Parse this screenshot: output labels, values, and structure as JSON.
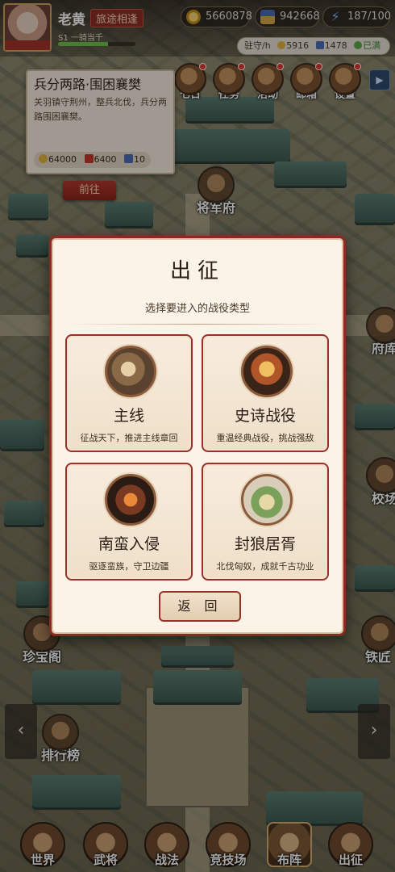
{
  "player": {
    "name": "老黄",
    "title_tag": "旅途相逢",
    "rank": "S1 一骑当千",
    "avatar_caption": "",
    "xp_fraction": 0.65
  },
  "resources": {
    "gold": "5660878",
    "medal": "942668",
    "energy": "187/100"
  },
  "garrison": {
    "label": "驻守/h",
    "gold": "5916",
    "medal": "1478",
    "status": "已满"
  },
  "top_icons": [
    {
      "label": "七日",
      "icon": "seven-day-icon",
      "badge": true
    },
    {
      "label": "任务",
      "icon": "quest-scroll-icon",
      "badge": true
    },
    {
      "label": "活动",
      "icon": "event-drum-icon",
      "badge": true
    },
    {
      "label": "邮箱",
      "icon": "mailbox-icon",
      "badge": true
    },
    {
      "label": "设置",
      "icon": "settings-icon",
      "badge": true
    }
  ],
  "quest": {
    "title": "兵分两路·围困襄樊",
    "description": "关羽镇守荆州，整兵北伐，兵分两路围困襄樊。",
    "rewards": {
      "gold": "64000",
      "medal": "6400",
      "troops": "10"
    },
    "go_button": "前往"
  },
  "map_buildings": {
    "general_hall": "将军府",
    "government_office": "府库",
    "training_ground": "校场",
    "treasure_pavilion": "珍宝阁",
    "blacksmith": "铁匠",
    "leaderboard": "排行榜"
  },
  "modal": {
    "title": "出征",
    "subtitle": "选择要进入的战役类型",
    "cards": [
      {
        "name": "主线",
        "desc": "征战天下，推进主线章回",
        "icon": "battle-flag-icon"
      },
      {
        "name": "史诗战役",
        "desc": "重温经典战役，挑战强敌",
        "icon": "palace-icon"
      },
      {
        "name": "南蛮入侵",
        "desc": "驱逐蛮族，守卫边疆",
        "icon": "barbarian-icon"
      },
      {
        "name": "封狼居胥",
        "desc": "北伐匈奴，成就千古功业",
        "icon": "mountain-flag-icon"
      }
    ],
    "back_button": "返 回"
  },
  "nav": {
    "left_arrow": "‹",
    "right_arrow": "›",
    "bottom": [
      {
        "label": "世界",
        "icon": "world-icon"
      },
      {
        "label": "武将",
        "icon": "generals-icon"
      },
      {
        "label": "战法",
        "icon": "tactics-icon"
      },
      {
        "label": "竞技场",
        "icon": "arena-icon"
      },
      {
        "label": "布阵",
        "icon": "formation-icon",
        "active": true
      },
      {
        "label": "出征",
        "icon": "expedition-icon"
      }
    ]
  }
}
